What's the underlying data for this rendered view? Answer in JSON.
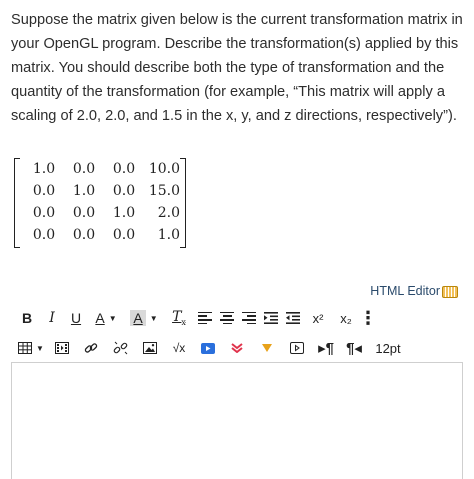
{
  "question": {
    "text": "Suppose the matrix given below is the current transformation matrix in your OpenGL program. Describe the transformation(s) applied by this matrix. You should describe both the type of transformation and the quantity of the transformation (for example, “This matrix will apply a scaling of 2.0, 2.0, and 1.5 in the x, y, and z directions, respectively”)."
  },
  "matrix": {
    "rows": [
      [
        "1.0",
        "0.0",
        "0.0",
        "10.0"
      ],
      [
        "0.0",
        "1.0",
        "0.0",
        "15.0"
      ],
      [
        "0.0",
        "0.0",
        "1.0",
        "2.0"
      ],
      [
        "0.0",
        "0.0",
        "0.0",
        "1.0"
      ]
    ]
  },
  "editor": {
    "html_editor_label": "HTML Editor",
    "font_size": "12pt",
    "content": "",
    "toolbar": {
      "bold": "B",
      "italic": "I",
      "underline": "U",
      "text_color": "A",
      "highlight": "A",
      "superscript": "x²",
      "subscript": "x₂",
      "equation": "√x"
    },
    "icons": [
      "bold-icon",
      "italic-icon",
      "underline-icon",
      "text-color-icon",
      "highlight-icon",
      "clear-formatting-icon",
      "align-left-icon",
      "align-center-icon",
      "align-right-icon",
      "indent-icon",
      "outdent-icon",
      "superscript-icon",
      "subscript-icon",
      "more-icon",
      "table-icon",
      "media-icon",
      "link-icon",
      "unlink-icon",
      "image-icon",
      "equation-icon",
      "record-icon",
      "apps-icon",
      "dropdown-icon",
      "embed-icon",
      "ltr-icon",
      "rtl-icon"
    ],
    "colors": {
      "accent_blue": "#1a5fd1",
      "record_blue": "#2a6fdc",
      "apps_red": "#e0334c",
      "dropdown_orange": "#e8a21a",
      "highlight_bg": "#d9d9d9"
    }
  }
}
